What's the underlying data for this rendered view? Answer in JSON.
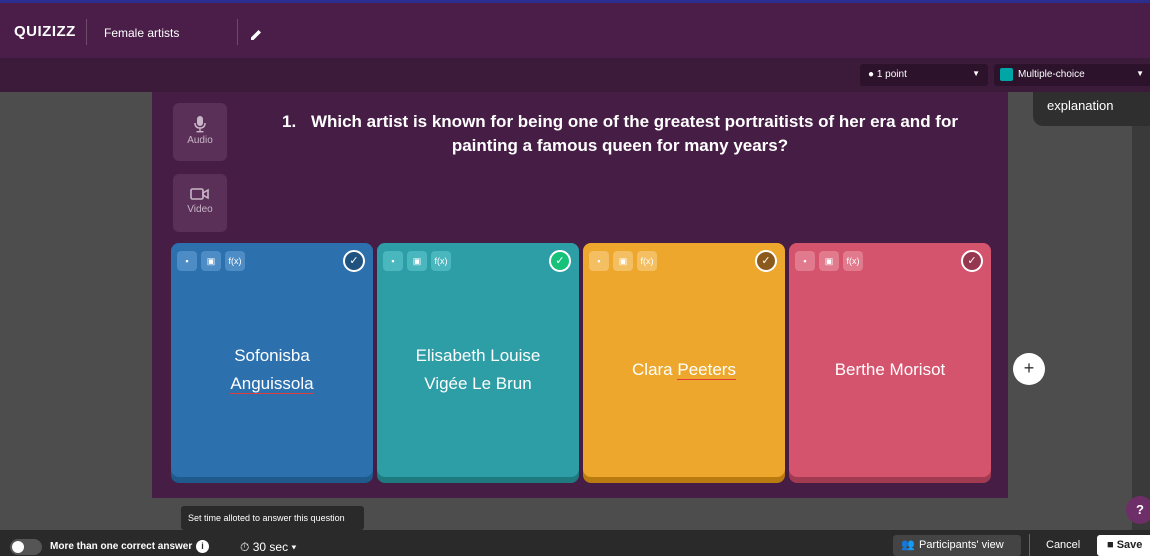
{
  "header": {
    "logo": "QUIZIZZ",
    "quiz_title": "Female artists"
  },
  "toolbar": {
    "points": "1 point",
    "question_type": "Multiple-choice"
  },
  "sidebar": {
    "audio_label": "Audio",
    "video_label": "Video",
    "explanation_label": "explanation"
  },
  "question": {
    "number": "1.",
    "text": "Which artist is known for being one of the greatest portraitists of her era and for painting a famous queen for many years?"
  },
  "answers": [
    {
      "line1": "Sofonisba",
      "line2": "Anguissola",
      "color": "#2d70ae",
      "correct": false
    },
    {
      "line1": "Elisabeth Louise",
      "line2": "Vigée Le Brun",
      "color": "#2d9da6",
      "correct": true
    },
    {
      "text_a": "Clara ",
      "text_b": "Peeters",
      "color": "#eca72c",
      "correct": false
    },
    {
      "text": "Berthe Morisot",
      "color": "#d5546d",
      "correct": false
    }
  ],
  "card_tools": {
    "delete_icon": "trash-icon",
    "image_icon": "image-icon",
    "formula_label": "f(x)"
  },
  "buttons": {
    "add": "+",
    "help": "?"
  },
  "tooltip": "Set time alloted to answer this question",
  "bottom": {
    "multi_correct_label": "More than one correct answer",
    "timer": "30 sec",
    "participants_view": "Participants' view",
    "cancel": "Cancel",
    "save": "Save"
  },
  "colors": {
    "header_bg": "#4a1e48",
    "correct_check": "#16c27a"
  }
}
